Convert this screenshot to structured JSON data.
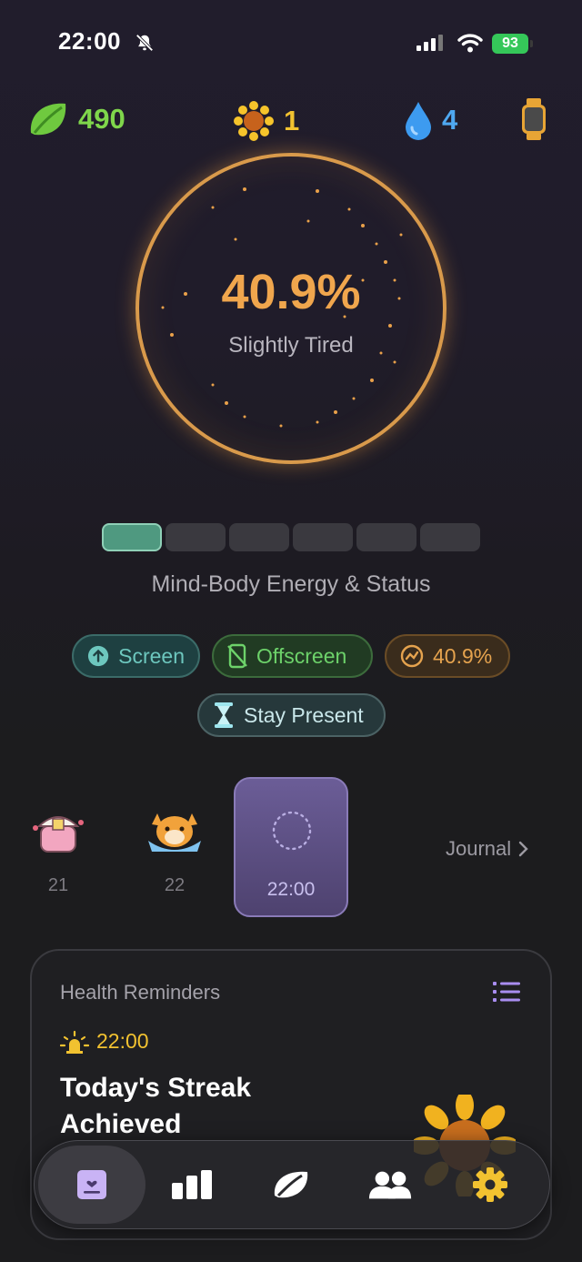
{
  "status_bar": {
    "time": "22:00",
    "battery": "93"
  },
  "resources": {
    "leaves": "490",
    "suns": "1",
    "drops": "4"
  },
  "energy": {
    "percent": "40.9%",
    "label": "Slightly Tired",
    "level_segments_active": 1,
    "level_segments_total": 6,
    "caption": "Mind-Body Energy & Status"
  },
  "pills": {
    "screen": "Screen",
    "offscreen": "Offscreen",
    "percent": "40.9%",
    "stay_present": "Stay Present"
  },
  "journal": {
    "days": [
      {
        "label": "21"
      },
      {
        "label": "22"
      }
    ],
    "current_time": "22:00",
    "link": "Journal"
  },
  "health": {
    "title": "Health Reminders",
    "time": "22:00",
    "headline": "Today's Streak Achieved"
  },
  "colors": {
    "accent_orange": "#f0a64d",
    "leaf_green": "#7fd64b",
    "sun_yellow": "#f2c230",
    "water_blue": "#4fa8f0",
    "journal_purple": "#6b5d97"
  },
  "icons": {
    "tabs": [
      "journal-icon",
      "stats-icon",
      "leaf-icon",
      "friends-icon",
      "settings-icon"
    ]
  }
}
